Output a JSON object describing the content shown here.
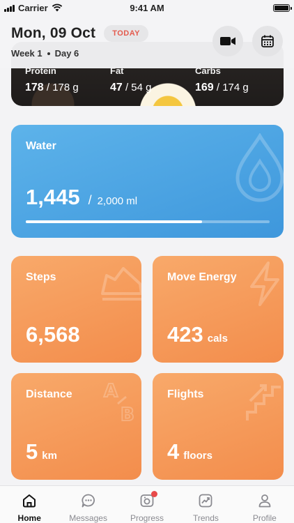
{
  "status_bar": {
    "carrier": "Carrier",
    "time": "9:41 AM"
  },
  "header": {
    "date": "Mon, 09 Oct",
    "today_badge": "TODAY",
    "week": "Week 1",
    "day": "Day 6",
    "video_icon": "video-camera-icon",
    "calendar_icon": "calendar-icon"
  },
  "macros": {
    "protein": {
      "label": "Protein",
      "value": "178",
      "goal": "/ 178 g"
    },
    "fat": {
      "label": "Fat",
      "value": "47",
      "goal": "/ 54 g"
    },
    "carbs": {
      "label": "Carbs",
      "value": "169",
      "goal": "/ 174 g"
    }
  },
  "water": {
    "title": "Water",
    "value": "1,445",
    "separator": "/",
    "goal": "2,000 ml",
    "progress_fraction": 0.7225,
    "icon": "water-drop-icon"
  },
  "steps": {
    "title": "Steps",
    "value": "6,568",
    "unit": "",
    "icon": "shoe-icon"
  },
  "move_energy": {
    "title": "Move Energy",
    "value": "423",
    "unit": "cals",
    "icon": "lightning-icon"
  },
  "distance": {
    "title": "Distance",
    "value": "5",
    "unit": "km",
    "icon": "a-to-b-icon"
  },
  "flights": {
    "title": "Flights",
    "value": "4",
    "unit": "floors",
    "icon": "stairs-icon"
  },
  "tabs": [
    {
      "label": "Home",
      "icon": "home-icon",
      "active": true
    },
    {
      "label": "Messages",
      "icon": "chat-icon",
      "active": false
    },
    {
      "label": "Progress",
      "icon": "camera-icon",
      "active": false,
      "badge": true
    },
    {
      "label": "Trends",
      "icon": "trend-chart-icon",
      "active": false
    },
    {
      "label": "Profile",
      "icon": "person-icon",
      "active": false
    }
  ],
  "colors": {
    "water": "#4aa3e2",
    "orange": "#f59a5a",
    "today_text": "#e45b4e",
    "badge_dot": "#e84a4a"
  }
}
